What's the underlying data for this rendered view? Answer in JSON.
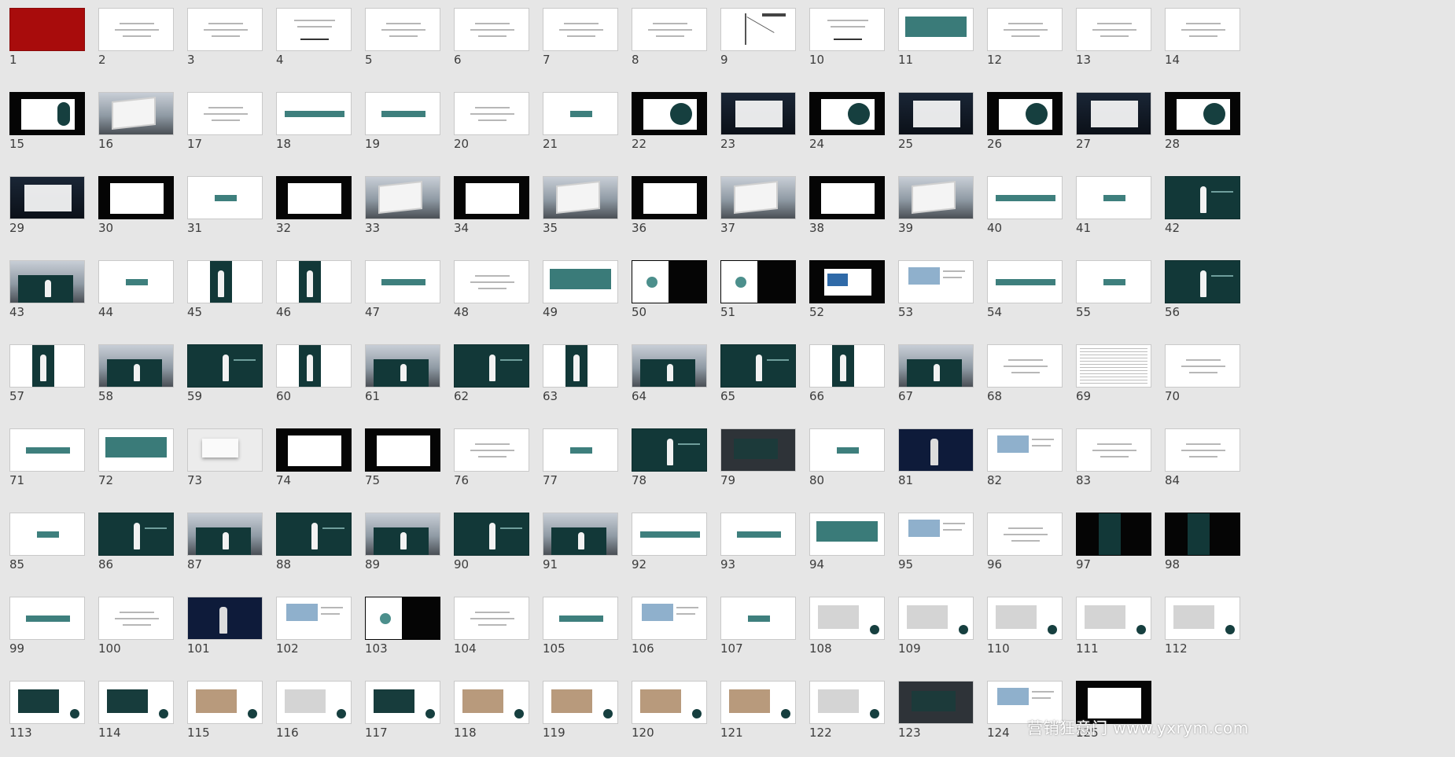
{
  "watermark": "营销狂意门 www.yxrym.com",
  "colors": {
    "background": "#e6e6e6",
    "accent_teal": "#3e7f7d",
    "dark_teal": "#123838",
    "cover_red": "#a80c0c"
  },
  "slides": [
    {
      "n": "1",
      "s": "red"
    },
    {
      "n": "2",
      "s": "text"
    },
    {
      "n": "3",
      "s": "text"
    },
    {
      "n": "4",
      "s": "char"
    },
    {
      "n": "5",
      "s": "text"
    },
    {
      "n": "6",
      "s": "text"
    },
    {
      "n": "7",
      "s": "text"
    },
    {
      "n": "8",
      "s": "text"
    },
    {
      "n": "9",
      "s": "diagram"
    },
    {
      "n": "10",
      "s": "char"
    },
    {
      "n": "11",
      "s": "tealcard"
    },
    {
      "n": "12",
      "s": "text"
    },
    {
      "n": "13",
      "s": "text"
    },
    {
      "n": "14",
      "s": "text"
    },
    {
      "n": "15",
      "s": "blackfig"
    },
    {
      "n": "16",
      "s": "billboard"
    },
    {
      "n": "17",
      "s": "text"
    },
    {
      "n": "18",
      "s": "barlong"
    },
    {
      "n": "19",
      "s": "bar"
    },
    {
      "n": "20",
      "s": "text"
    },
    {
      "n": "21",
      "s": "barshort"
    },
    {
      "n": "22",
      "s": "blackcircle"
    },
    {
      "n": "23",
      "s": "city"
    },
    {
      "n": "24",
      "s": "blackcircle"
    },
    {
      "n": "25",
      "s": "city"
    },
    {
      "n": "26",
      "s": "blackcircle"
    },
    {
      "n": "27",
      "s": "city"
    },
    {
      "n": "28",
      "s": "blackcircle"
    },
    {
      "n": "29",
      "s": "city"
    },
    {
      "n": "30",
      "s": "black"
    },
    {
      "n": "31",
      "s": "barshort"
    },
    {
      "n": "32",
      "s": "black"
    },
    {
      "n": "33",
      "s": "billboard"
    },
    {
      "n": "34",
      "s": "black"
    },
    {
      "n": "35",
      "s": "billboard"
    },
    {
      "n": "36",
      "s": "black"
    },
    {
      "n": "37",
      "s": "billboard"
    },
    {
      "n": "38",
      "s": "black"
    },
    {
      "n": "39",
      "s": "billboard"
    },
    {
      "n": "40",
      "s": "barlong"
    },
    {
      "n": "41",
      "s": "barshort"
    },
    {
      "n": "42",
      "s": "tealfig"
    },
    {
      "n": "43",
      "s": "photo"
    },
    {
      "n": "44",
      "s": "barshort"
    },
    {
      "n": "45",
      "s": "centerpanel"
    },
    {
      "n": "46",
      "s": "centerpanel"
    },
    {
      "n": "47",
      "s": "bar"
    },
    {
      "n": "48",
      "s": "text"
    },
    {
      "n": "49",
      "s": "tealcard"
    },
    {
      "n": "50",
      "s": "split"
    },
    {
      "n": "51",
      "s": "split"
    },
    {
      "n": "52",
      "s": "blackdoc"
    },
    {
      "n": "53",
      "s": "doc"
    },
    {
      "n": "54",
      "s": "barlong"
    },
    {
      "n": "55",
      "s": "barshort"
    },
    {
      "n": "56",
      "s": "tealfig"
    },
    {
      "n": "57",
      "s": "centerpanel"
    },
    {
      "n": "58",
      "s": "photo"
    },
    {
      "n": "59",
      "s": "tealfig"
    },
    {
      "n": "60",
      "s": "centerpanel"
    },
    {
      "n": "61",
      "s": "photo"
    },
    {
      "n": "62",
      "s": "tealfig"
    },
    {
      "n": "63",
      "s": "centerpanel"
    },
    {
      "n": "64",
      "s": "photo"
    },
    {
      "n": "65",
      "s": "tealfig"
    },
    {
      "n": "66",
      "s": "centerpanel"
    },
    {
      "n": "67",
      "s": "photo"
    },
    {
      "n": "68",
      "s": "text"
    },
    {
      "n": "69",
      "s": "dense"
    },
    {
      "n": "70",
      "s": "text"
    },
    {
      "n": "71",
      "s": "bar"
    },
    {
      "n": "72",
      "s": "tealcard"
    },
    {
      "n": "73",
      "s": "photolight"
    },
    {
      "n": "74",
      "s": "black"
    },
    {
      "n": "75",
      "s": "black"
    },
    {
      "n": "76",
      "s": "text"
    },
    {
      "n": "77",
      "s": "barshort"
    },
    {
      "n": "78",
      "s": "tealfig"
    },
    {
      "n": "79",
      "s": "dark"
    },
    {
      "n": "80",
      "s": "barshort"
    },
    {
      "n": "81",
      "s": "navy"
    },
    {
      "n": "82",
      "s": "doc"
    },
    {
      "n": "83",
      "s": "text"
    },
    {
      "n": "84",
      "s": "text"
    },
    {
      "n": "85",
      "s": "barshort"
    },
    {
      "n": "86",
      "s": "tealfig"
    },
    {
      "n": "87",
      "s": "photo"
    },
    {
      "n": "88",
      "s": "tealfig"
    },
    {
      "n": "89",
      "s": "photo"
    },
    {
      "n": "90",
      "s": "tealfig"
    },
    {
      "n": "91",
      "s": "photo"
    },
    {
      "n": "92",
      "s": "barlong"
    },
    {
      "n": "93",
      "s": "bar"
    },
    {
      "n": "94",
      "s": "tealcard"
    },
    {
      "n": "95",
      "s": "doc"
    },
    {
      "n": "96",
      "s": "text"
    },
    {
      "n": "97",
      "s": "blackpanel"
    },
    {
      "n": "98",
      "s": "blackpanel"
    },
    {
      "n": "99",
      "s": "bar"
    },
    {
      "n": "100",
      "s": "text"
    },
    {
      "n": "101",
      "s": "navy"
    },
    {
      "n": "102",
      "s": "doc"
    },
    {
      "n": "103",
      "s": "split"
    },
    {
      "n": "104",
      "s": "text"
    },
    {
      "n": "105",
      "s": "bar"
    },
    {
      "n": "106",
      "s": "doc"
    },
    {
      "n": "107",
      "s": "barshort"
    },
    {
      "n": "108",
      "s": "brand"
    },
    {
      "n": "109",
      "s": "brand"
    },
    {
      "n": "110",
      "s": "brand"
    },
    {
      "n": "111",
      "s": "brand"
    },
    {
      "n": "112",
      "s": "brand"
    },
    {
      "n": "113",
      "s": "brandteal"
    },
    {
      "n": "114",
      "s": "brandteal"
    },
    {
      "n": "115",
      "s": "brandwarm"
    },
    {
      "n": "116",
      "s": "brand"
    },
    {
      "n": "117",
      "s": "brandteal"
    },
    {
      "n": "118",
      "s": "brandwarm"
    },
    {
      "n": "119",
      "s": "brandwarm"
    },
    {
      "n": "120",
      "s": "brandwarm"
    },
    {
      "n": "121",
      "s": "brandwarm"
    },
    {
      "n": "122",
      "s": "brand"
    },
    {
      "n": "123",
      "s": "dark"
    },
    {
      "n": "124",
      "s": "doc"
    },
    {
      "n": "125",
      "s": "black"
    }
  ]
}
